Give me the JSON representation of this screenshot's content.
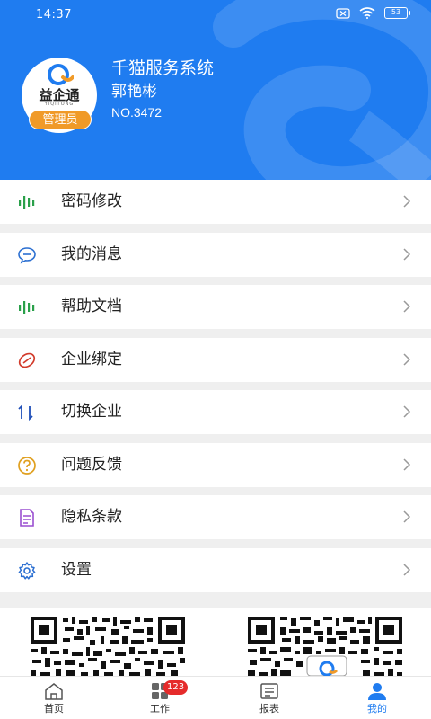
{
  "status": {
    "time": "14:37",
    "battery": "53"
  },
  "profile": {
    "system_name": "千猫服务系统",
    "user_name": "郭艳彬",
    "user_no": "NO.3472",
    "logo_text": "益企通",
    "logo_sub": "YIQITONG",
    "role_badge": "管理员"
  },
  "menu": [
    {
      "label": "密码修改",
      "icon": "signal-bars-icon",
      "color": "#2aa04a"
    },
    {
      "label": "我的消息",
      "icon": "chat-bubble-icon",
      "color": "#2b6fd1"
    },
    {
      "label": "帮助文档",
      "icon": "signal-bars-icon",
      "color": "#2aa04a"
    },
    {
      "label": "企业绑定",
      "icon": "link-icon",
      "color": "#d23a2a"
    },
    {
      "label": "切换企业",
      "icon": "switch-arrows-icon",
      "color": "#1f4fb8"
    },
    {
      "label": "问题反馈",
      "icon": "question-icon",
      "color": "#e0a020"
    },
    {
      "label": "隐私条款",
      "icon": "document-icon",
      "color": "#9a4fd0"
    },
    {
      "label": "设置",
      "icon": "gear-icon",
      "color": "#2b6fd1"
    }
  ],
  "nav": {
    "items": [
      {
        "label": "首页",
        "icon": "home-icon"
      },
      {
        "label": "工作",
        "icon": "grid-icon"
      },
      {
        "label": "报表",
        "icon": "report-icon"
      },
      {
        "label": "我的",
        "icon": "person-icon"
      }
    ],
    "work_badge": "123",
    "active_index": 3
  },
  "colors": {
    "primary": "#1f7cf0",
    "badge": "#f09a28",
    "alert": "#e52b2b"
  }
}
